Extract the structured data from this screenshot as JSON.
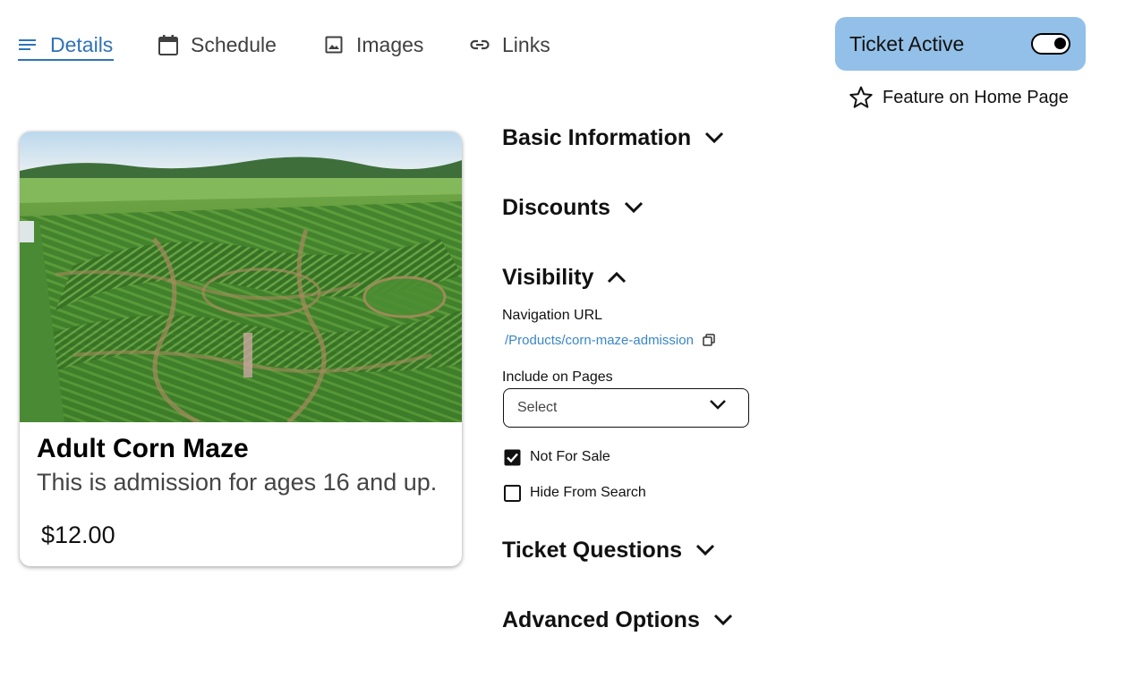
{
  "tabs": [
    {
      "label": "Details",
      "icon": "menu-lines-icon",
      "active": true
    },
    {
      "label": "Schedule",
      "icon": "calendar-icon",
      "active": false
    },
    {
      "label": "Images",
      "icon": "image-icon",
      "active": false
    },
    {
      "label": "Links",
      "icon": "link-icon",
      "active": false
    }
  ],
  "status": {
    "ticket_active_label": "Ticket Active",
    "ticket_active_on": true,
    "feature_label": "Feature on Home Page",
    "feature_icon": "star-outline-icon"
  },
  "card": {
    "image_alt": "corn-maze-photo",
    "title": "Adult Corn Maze",
    "description": "This is admission for ages 16 and up.",
    "price": "$12.00"
  },
  "sections": {
    "basic": "Basic Information",
    "discounts": "Discounts",
    "visibility": "Visibility",
    "questions": "Ticket Questions",
    "advanced": "Advanced Options"
  },
  "visibility": {
    "nav_url_label": "Navigation URL",
    "nav_url": "/Products/corn-maze-admission",
    "include_label": "Include on Pages",
    "include_placeholder": "Select",
    "not_for_sale_label": "Not For Sale",
    "not_for_sale_checked": true,
    "hide_search_label": "Hide From Search",
    "hide_search_checked": false
  },
  "colors": {
    "accent": "#2f73b8",
    "pill": "#92c0e8",
    "link": "#3a86c8"
  }
}
